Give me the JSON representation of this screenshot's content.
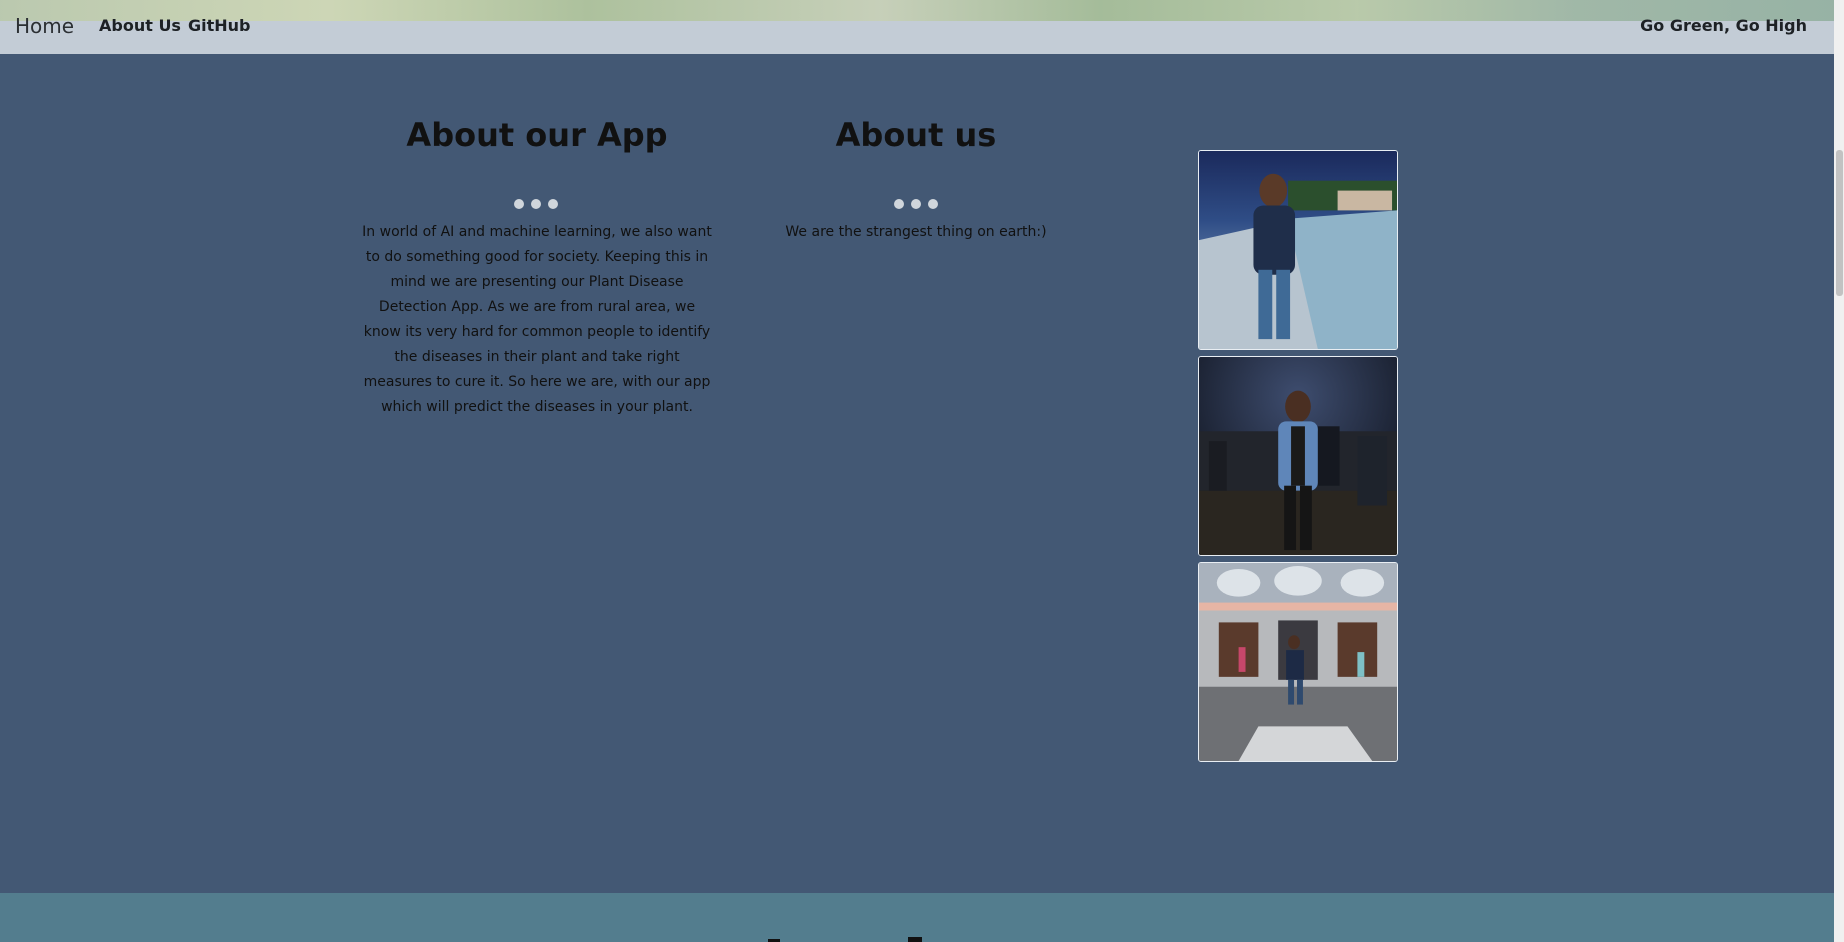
{
  "navbar": {
    "brand": "Home",
    "links": [
      {
        "label": "About Us"
      },
      {
        "label": "GitHub"
      }
    ],
    "slogan": "Go Green, Go High"
  },
  "about_app": {
    "title": "About our App",
    "text": "In world of AI and machine learning, we also want to do something good for society. Keeping this in mind we are presenting our Plant Disease Detection App. As we are from rural area, we know its very hard for common people to identify the diseases in their plant and take right measures to cure it. So here we are, with our app which will predict the diseases in your plant."
  },
  "about_us": {
    "title": "About us",
    "text": "We are the strangest thing on earth:)"
  },
  "colors": {
    "page_background": "#435874",
    "navbar": "#c3ccd6",
    "next_section": "#537d8e",
    "dot": "#d0d6dc"
  }
}
